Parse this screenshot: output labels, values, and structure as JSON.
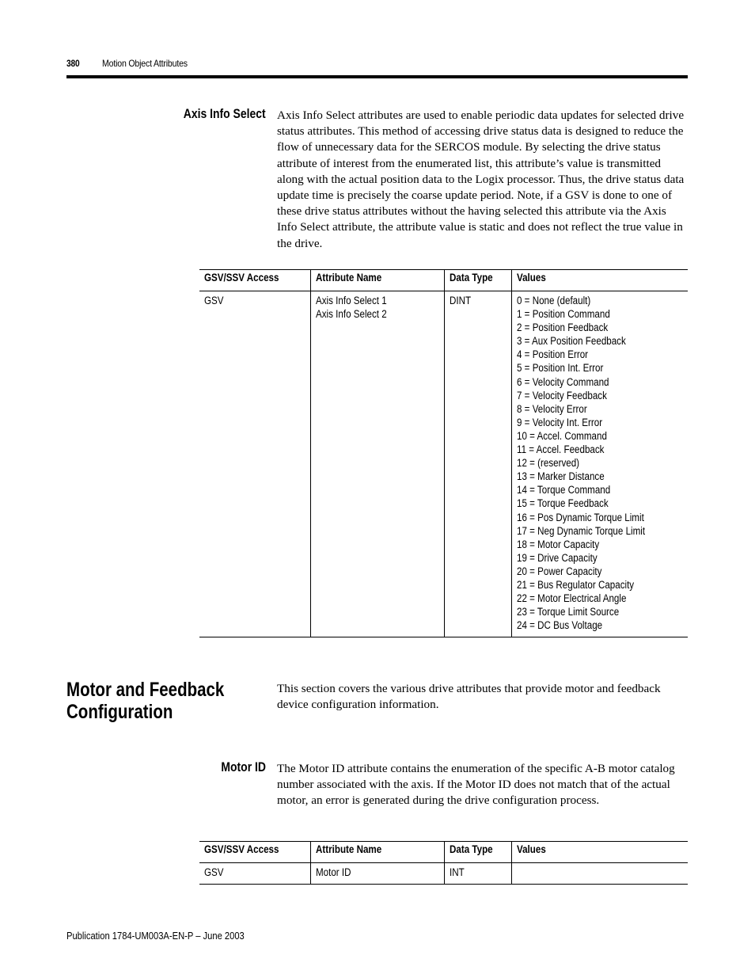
{
  "header": {
    "page_number": "380",
    "running_title": "Motion Object Attributes"
  },
  "sections": {
    "axis_info_select": {
      "heading": "Axis Info Select",
      "body": "Axis Info Select attributes are used to enable periodic data updates for selected drive status attributes. This method of accessing drive status data is designed to reduce the flow of unnecessary data for the SERCOS module. By selecting the drive status attribute of interest from the enumerated list, this attribute’s value is transmitted along with the actual position data to the Logix processor. Thus, the drive status data update time is precisely the coarse update period. Note, if a GSV is done to one of these drive status attributes without the having selected this attribute via the Axis Info Select attribute, the attribute value is static and does not reflect the true value in the drive.",
      "table": {
        "headers": [
          "GSV/SSV Access",
          "Attribute Name",
          "Data Type",
          "Values"
        ],
        "row": {
          "access": "GSV",
          "attribute_names": [
            "Axis Info Select 1",
            "Axis Info Select 2"
          ],
          "data_type": "DINT",
          "values": [
            "0 = None (default)",
            "1 = Position Command",
            "2 = Position Feedback",
            "3 = Aux Position Feedback",
            "4 = Position Error",
            "5 = Position Int. Error",
            "6 = Velocity Command",
            "7 = Velocity Feedback",
            "8 = Velocity Error",
            "9 = Velocity Int. Error",
            "10 = Accel. Command",
            "11 = Accel. Feedback",
            "12 = (reserved)",
            "13 = Marker Distance",
            "14 = Torque Command",
            "15 = Torque Feedback",
            "16 = Pos Dynamic Torque Limit",
            "17 = Neg Dynamic Torque Limit",
            "18 = Motor Capacity",
            "19 = Drive Capacity",
            "20 = Power Capacity",
            "21 = Bus Regulator Capacity",
            "22 = Motor Electrical Angle",
            "23 = Torque Limit Source",
            "24 = DC Bus Voltage"
          ]
        }
      }
    },
    "motor_feedback": {
      "heading_line1": "Motor and Feedback",
      "heading_line2": "Configuration",
      "body": "This section covers the various drive attributes that provide motor and feedback device configuration information."
    },
    "motor_id": {
      "heading": "Motor ID",
      "body": "The Motor ID attribute contains the enumeration of the specific A-B motor catalog number associated with the axis. If the Motor ID does not match that of the actual motor, an error is generated during the drive configuration process.",
      "table": {
        "headers": [
          "GSV/SSV Access",
          "Attribute Name",
          "Data Type",
          "Values"
        ],
        "row": {
          "access": "GSV",
          "attribute_name": "Motor ID",
          "data_type": "INT",
          "values": ""
        }
      }
    }
  },
  "footer": {
    "publication": "Publication 1784-UM003A-EN-P – June 2003"
  }
}
